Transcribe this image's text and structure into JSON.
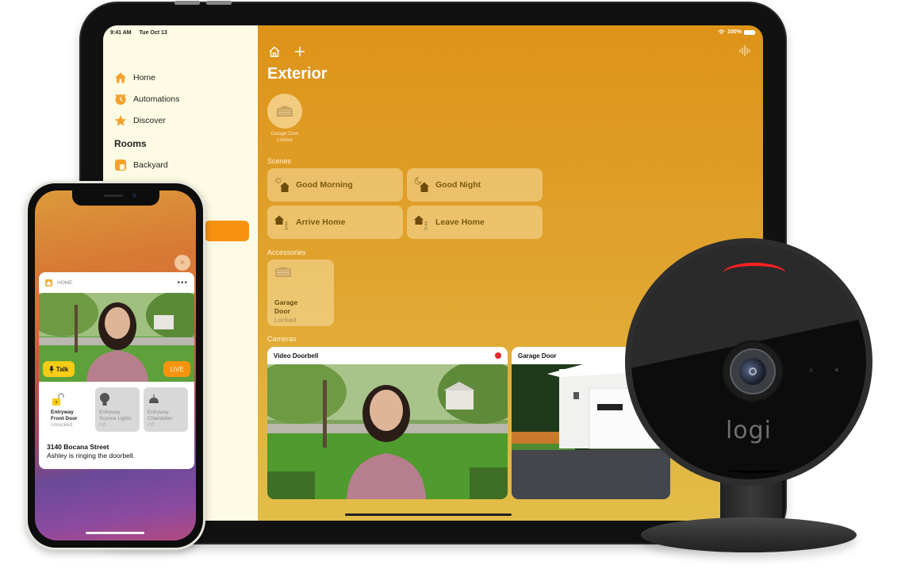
{
  "ipad": {
    "status": {
      "time": "9:41 AM",
      "date": "Tue Oct 13",
      "battery": "100%"
    },
    "sidebar": {
      "items": [
        {
          "label": "Home",
          "icon": "house-icon"
        },
        {
          "label": "Automations",
          "icon": "clock-icon"
        },
        {
          "label": "Discover",
          "icon": "star-icon"
        }
      ],
      "rooms_heading": "Rooms",
      "rooms": [
        {
          "label": "Backyard",
          "icon": "room-icon"
        }
      ]
    },
    "main": {
      "title": "Exterior",
      "favorite": {
        "name": "Garage Door",
        "state": "Locked"
      },
      "scenes_heading": "Scenes",
      "scenes": [
        {
          "label": "Good Morning",
          "icon": "sun-house-icon"
        },
        {
          "label": "Good Night",
          "icon": "moon-house-icon"
        },
        {
          "label": "Arrive Home",
          "icon": "arrive-home-icon"
        },
        {
          "label": "Leave Home",
          "icon": "leave-home-icon"
        }
      ],
      "accessories_heading": "Accessories",
      "accessories": [
        {
          "name_line1": "Garage",
          "name_line2": "Door",
          "state": "Locked"
        }
      ],
      "cameras_heading": "Cameras",
      "cameras": [
        {
          "name": "Video Doorbell",
          "recording": true
        },
        {
          "name": "Garage Door",
          "recording": false
        }
      ]
    },
    "colors": {
      "accent": "#f7920f",
      "sidebar_bg": "#fdfbe4",
      "main_top": "#de9318",
      "main_bottom": "#e3bd49"
    }
  },
  "iphone": {
    "close_label": "×",
    "notification": {
      "app": "HOME",
      "more": "•••",
      "talk_label": "Talk",
      "live_label": "LIVE",
      "tiles": [
        {
          "line1": "Entryway",
          "line2": "Front Door",
          "state": "Unlocked"
        },
        {
          "line1": "Entryway",
          "line2": "Sconce Lights",
          "state": "Off"
        },
        {
          "line1": "Entryway",
          "line2": "Chandelier",
          "state": "Off"
        }
      ],
      "address": "3140 Bocana Street",
      "message": "Ashley is ringing the doorbell."
    }
  },
  "device": {
    "brand": "logi"
  }
}
